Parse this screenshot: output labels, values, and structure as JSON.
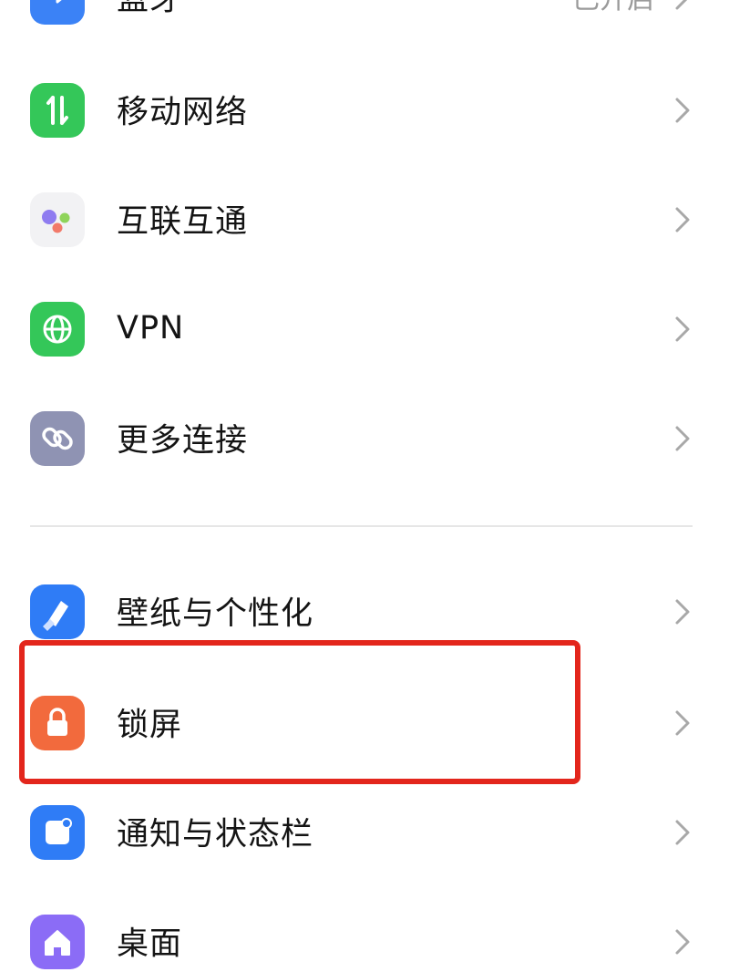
{
  "settings": {
    "items": [
      {
        "label": "蓝牙",
        "value": "已开启",
        "icon": "bluetooth-icon",
        "color": "#3b82f6"
      },
      {
        "label": "移动网络",
        "value": "",
        "icon": "mobile-data-icon",
        "color": "#34c759"
      },
      {
        "label": "互联互通",
        "value": "",
        "icon": "interconnect-icon",
        "color": "#f2f2f4"
      },
      {
        "label": "VPN",
        "value": "",
        "icon": "globe-icon",
        "color": "#34c759"
      },
      {
        "label": "更多连接",
        "value": "",
        "icon": "link-icon",
        "color": "#8f93b3"
      },
      {
        "label": "壁纸与个性化",
        "value": "",
        "icon": "brush-icon",
        "color": "#2f7cf6"
      },
      {
        "label": "锁屏",
        "value": "",
        "icon": "lock-icon",
        "color": "#f26a3d"
      },
      {
        "label": "通知与状态栏",
        "value": "",
        "icon": "notification-icon",
        "color": "#2f7cf6"
      },
      {
        "label": "桌面",
        "value": "",
        "icon": "home-icon",
        "color": "#8b6cf6"
      }
    ]
  },
  "annotation": {
    "highlight_color": "#e3261c"
  }
}
